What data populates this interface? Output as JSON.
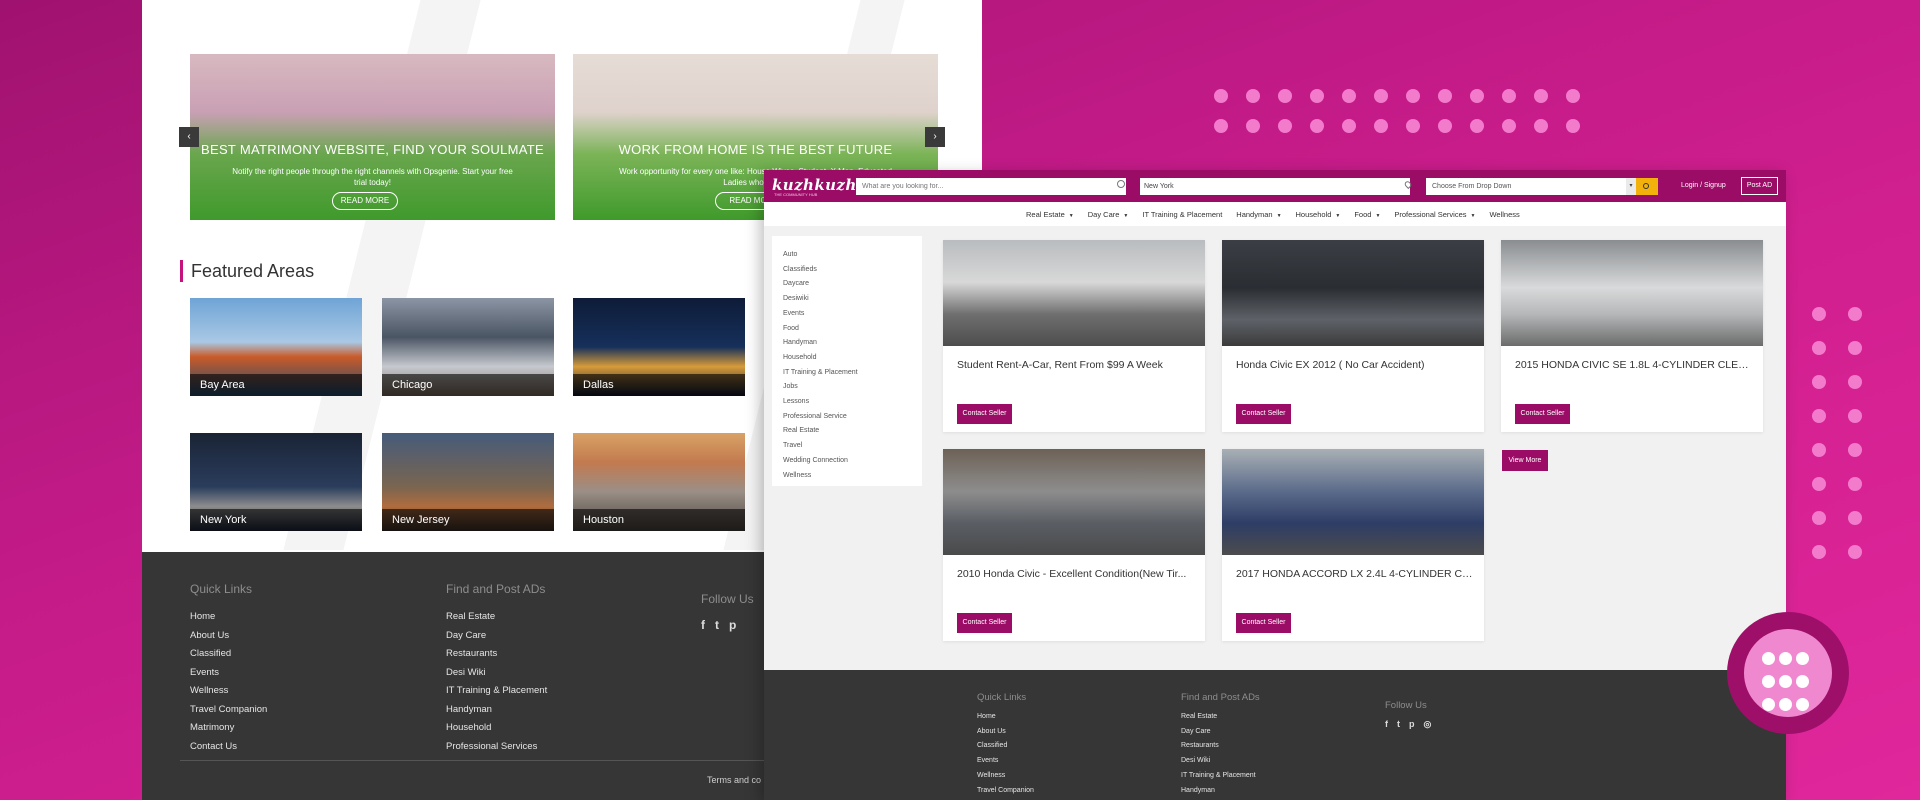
{
  "left_site": {
    "slides": [
      {
        "title": "BEST MATRIMONY WEBSITE, FIND YOUR SOULMATE",
        "subtitle": "Notify the right people through the right channels with Opsgenie. Start your free trial today!",
        "button": "READ MORE"
      },
      {
        "title": "WORK FROM HOME IS THE BEST FUTURE",
        "subtitle": "Work opportunity for every one like: House Wives, Student, X Men, Educated Ladies who are sit",
        "button": "READ MO"
      }
    ],
    "arrow_prev": "‹",
    "arrow_next": "›",
    "featured_title": "Featured Areas",
    "areas": [
      "Bay Area",
      "Chicago",
      "Dallas",
      "New York",
      "New Jersey",
      "Houston"
    ],
    "footer": {
      "quick_links_title": "Quick Links",
      "quick_links": [
        "Home",
        "About Us",
        "Classified",
        "Events",
        "Wellness",
        "Travel Companion",
        "Matrimony",
        "Contact Us"
      ],
      "find_post_title": "Find and Post ADs",
      "find_post": [
        "Real Estate",
        "Day Care",
        "Restaurants",
        "Desi Wiki",
        "IT Training & Placement",
        "Handyman",
        "Household",
        "Professional Services"
      ],
      "follow_title": "Follow Us",
      "social": [
        "f",
        "t",
        "p"
      ],
      "terms": "Terms and co"
    }
  },
  "right_site": {
    "logo": "kuzhkuzh",
    "logo_sub": "THE COMMUNITY HUB",
    "search_placeholder": "What are you looking for...",
    "location": "New York",
    "dropdown": "Choose From Drop Down",
    "caret": "▾",
    "login": "Login / Signup",
    "post_ad": "Post AD",
    "nav": [
      {
        "label": "Real Estate",
        "caret": "▼"
      },
      {
        "label": "Day Care",
        "caret": "▼"
      },
      {
        "label": "IT Training & Placement",
        "caret": ""
      },
      {
        "label": "Handyman",
        "caret": "▼"
      },
      {
        "label": "Household",
        "caret": "▼"
      },
      {
        "label": "Food",
        "caret": "▼"
      },
      {
        "label": "Professional Services",
        "caret": "▼"
      },
      {
        "label": "Wellness",
        "caret": ""
      }
    ],
    "categories": [
      "Auto",
      "Classifieds",
      "Daycare",
      "Desiwiki",
      "Events",
      "Food",
      "Handyman",
      "Household",
      "IT Training & Placement",
      "Jobs",
      "Lessons",
      "Professional Service",
      "Real Estate",
      "Travel",
      "Wedding Connection",
      "Wellness"
    ],
    "listings": [
      {
        "title": "Student Rent-A-Car, Rent From $99 A Week",
        "button": "Contact Seller"
      },
      {
        "title": "Honda Civic EX 2012 ( No Car Accident)",
        "button": "Contact Seller"
      },
      {
        "title": "2015 HONDA CIVIC SE 1.8L 4-CYLINDER CLEAN ...",
        "button": "Contact Seller"
      },
      {
        "title": "2010 Honda Civic - Excellent Condition(New Tir...",
        "button": "Contact Seller"
      },
      {
        "title": "2017 HONDA ACCORD LX 2.4L 4-CYLINDER CLE...",
        "button": "Contact Seller"
      }
    ],
    "view_more": "View More",
    "footer": {
      "quick_links_title": "Quick Links",
      "quick_links": [
        "Home",
        "About Us",
        "Classified",
        "Events",
        "Wellness",
        "Travel Companion"
      ],
      "find_post_title": "Find and Post ADs",
      "find_post": [
        "Real Estate",
        "Day Care",
        "Restaurants",
        "Desi Wiki",
        "IT Training & Placement",
        "Handyman"
      ],
      "follow_title": "Follow Us",
      "social": [
        "f",
        "t",
        "p",
        "◎"
      ]
    }
  },
  "colors": {
    "brand": "#9a0c66",
    "accent": "#f3b20b",
    "background": "#c01a86",
    "footer": "#363636"
  }
}
